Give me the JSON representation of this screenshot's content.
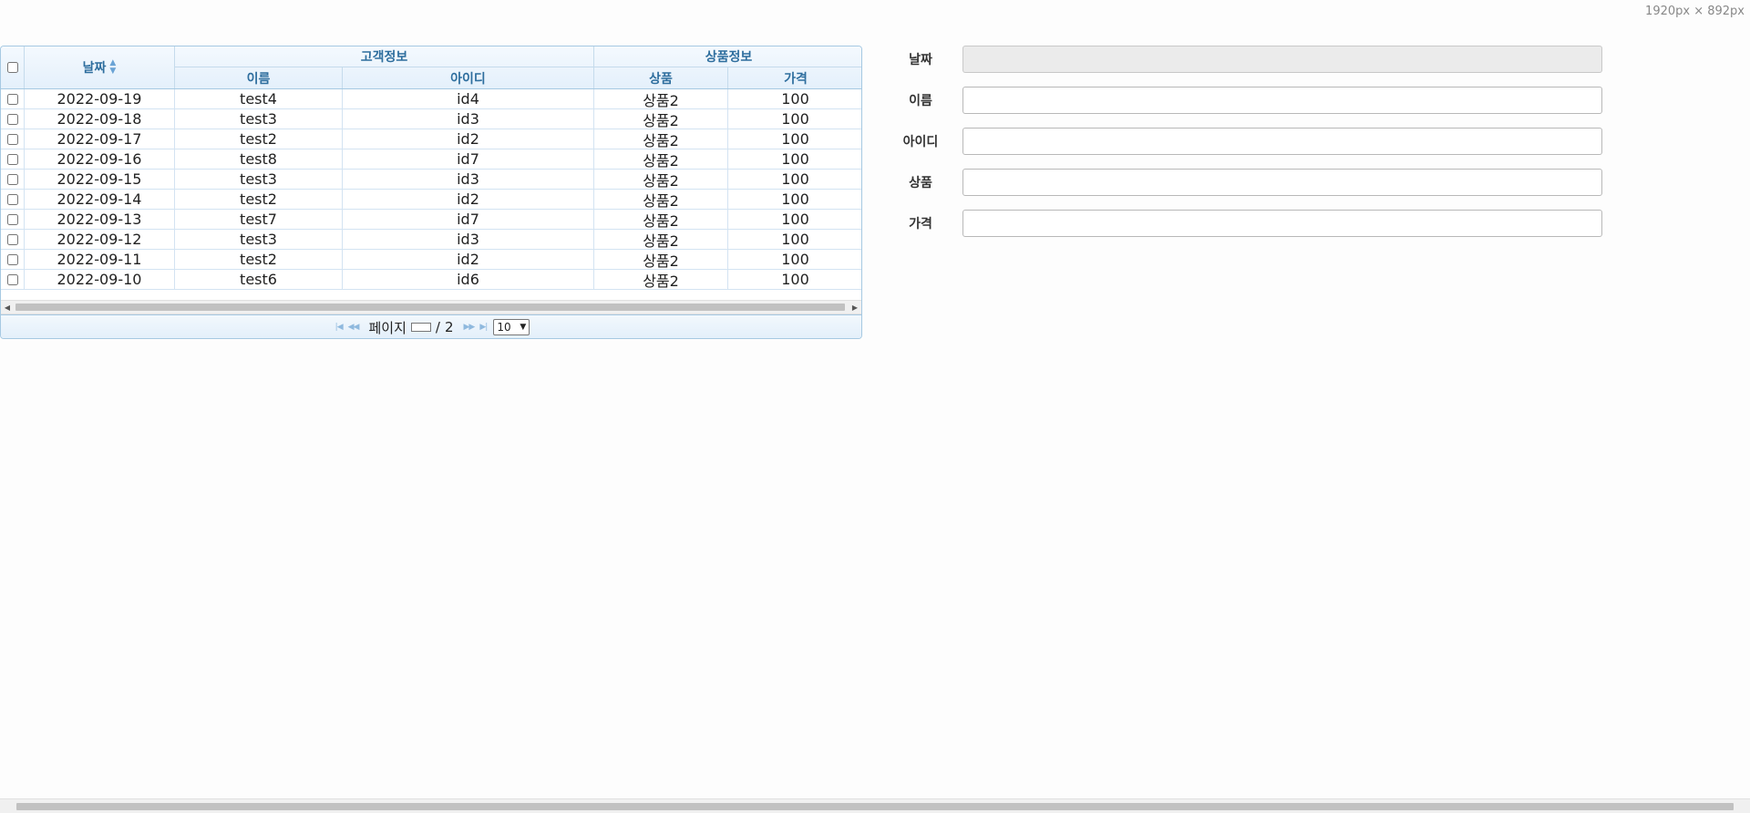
{
  "dims_label": "1920px × 892px",
  "grid": {
    "headers": {
      "date": "날짜",
      "group_customer": "고객정보",
      "group_product": "상품정보",
      "name": "이름",
      "id": "아이디",
      "product": "상품",
      "price": "가격"
    },
    "rows": [
      {
        "date": "2022-09-19",
        "name": "test4",
        "id": "id4",
        "product": "상품2",
        "price": "100"
      },
      {
        "date": "2022-09-18",
        "name": "test3",
        "id": "id3",
        "product": "상품2",
        "price": "100"
      },
      {
        "date": "2022-09-17",
        "name": "test2",
        "id": "id2",
        "product": "상품2",
        "price": "100"
      },
      {
        "date": "2022-09-16",
        "name": "test8",
        "id": "id7",
        "product": "상품2",
        "price": "100"
      },
      {
        "date": "2022-09-15",
        "name": "test3",
        "id": "id3",
        "product": "상품2",
        "price": "100"
      },
      {
        "date": "2022-09-14",
        "name": "test2",
        "id": "id2",
        "product": "상품2",
        "price": "100"
      },
      {
        "date": "2022-09-13",
        "name": "test7",
        "id": "id7",
        "product": "상품2",
        "price": "100"
      },
      {
        "date": "2022-09-12",
        "name": "test3",
        "id": "id3",
        "product": "상품2",
        "price": "100"
      },
      {
        "date": "2022-09-11",
        "name": "test2",
        "id": "id2",
        "product": "상품2",
        "price": "100"
      },
      {
        "date": "2022-09-10",
        "name": "test6",
        "id": "id6",
        "product": "상품2",
        "price": "100"
      }
    ],
    "pager": {
      "page_label": "페이지",
      "separator": "/",
      "total_pages": "2",
      "rows_per_page": "10"
    }
  },
  "form": {
    "date_label": "날짜",
    "name_label": "이름",
    "id_label": "아이디",
    "product_label": "상품",
    "price_label": "가격"
  },
  "icons": {
    "sort": "sort-icon",
    "first": "first-page-icon",
    "prev": "prev-page-icon",
    "next": "next-page-icon",
    "last": "last-page-icon"
  }
}
